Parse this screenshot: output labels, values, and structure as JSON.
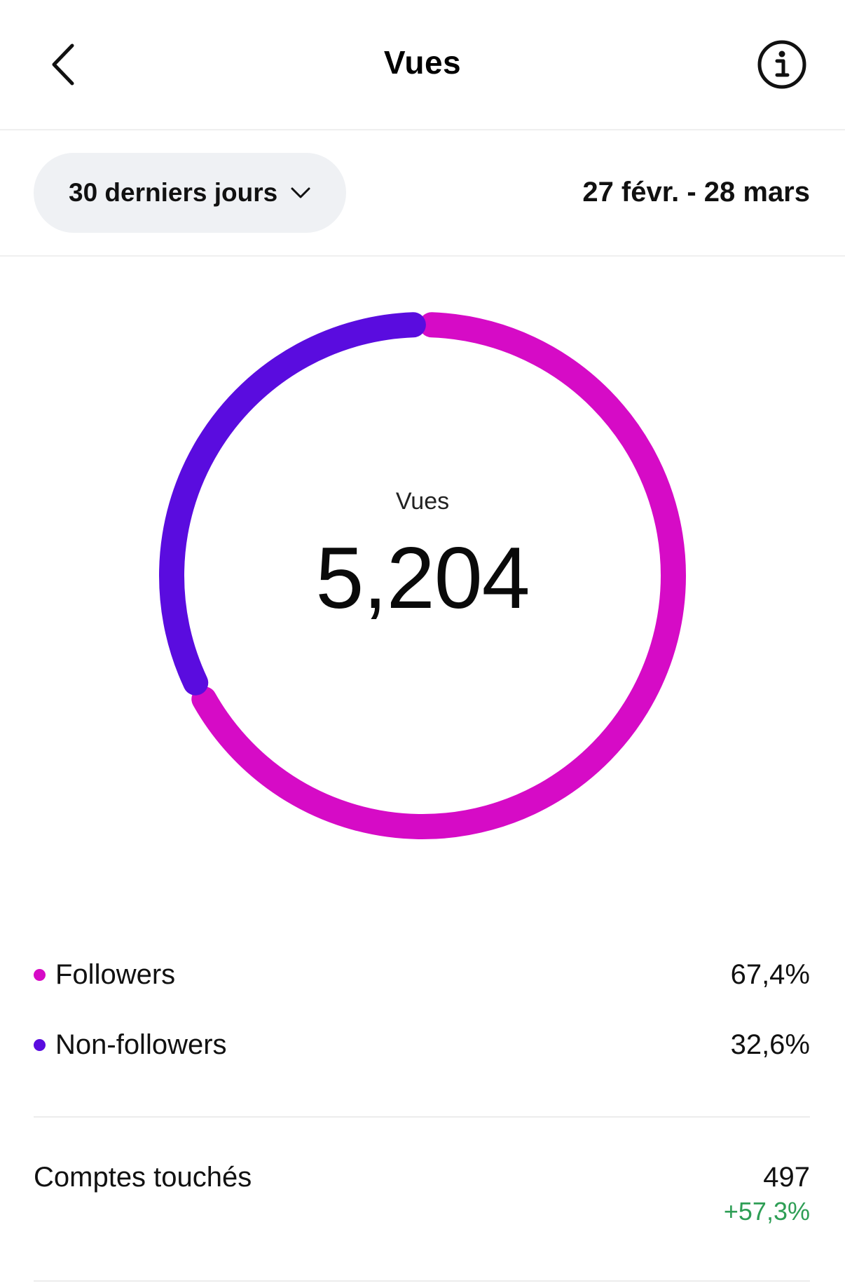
{
  "header": {
    "title": "Vues",
    "back_icon": "chevron-left-icon",
    "info_icon": "info-icon"
  },
  "filter": {
    "range_label": "30 derniers jours",
    "dropdown_icon": "chevron-down-icon",
    "date_range": "27 févr. - 28 mars"
  },
  "summary": {
    "label": "Vues",
    "value": "5,204"
  },
  "chart_data": {
    "type": "pie",
    "series": [
      {
        "name": "Followers",
        "value": 67.4,
        "color": "#d60bc6"
      },
      {
        "name": "Non-followers",
        "value": 32.6,
        "color": "#5a0cdf"
      }
    ]
  },
  "legend": [
    {
      "name": "Followers",
      "value": "67,4%",
      "color": "#d60bc6"
    },
    {
      "name": "Non-followers",
      "value": "32,6%",
      "color": "#5a0cdf"
    }
  ],
  "metrics": {
    "accounts_reached": {
      "label": "Comptes touchés",
      "value": "497",
      "change": "+57,3%",
      "change_color": "#2e9e55"
    }
  }
}
